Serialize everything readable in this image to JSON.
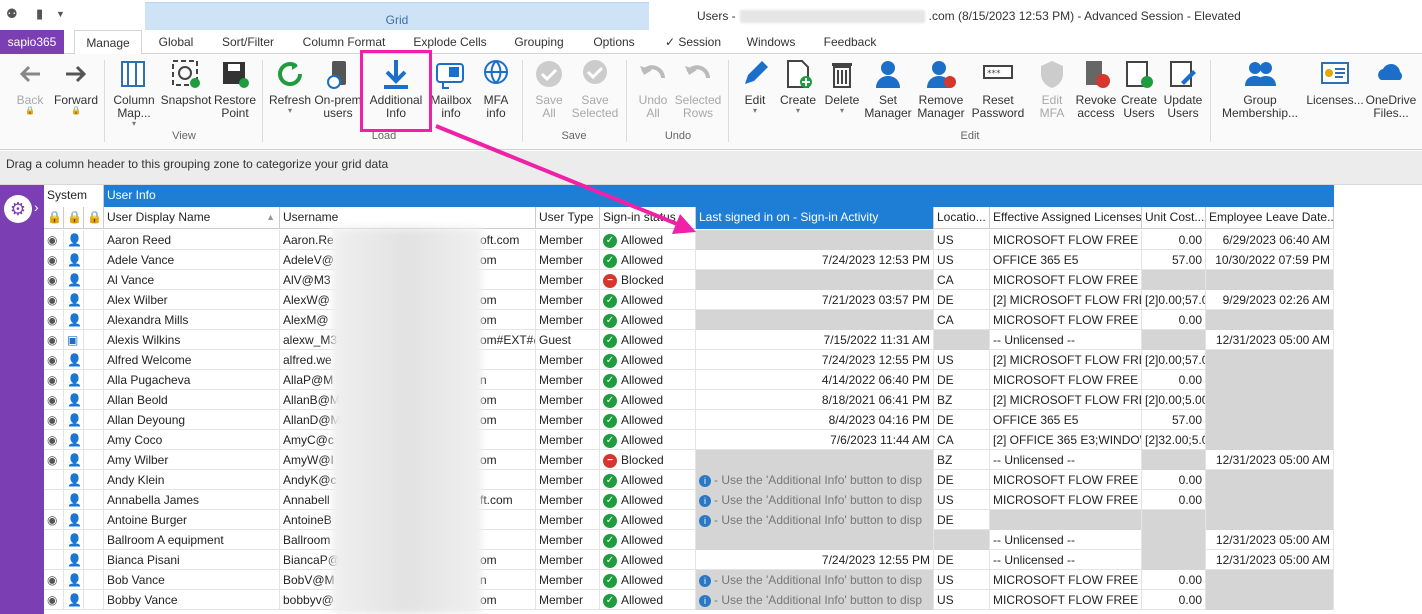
{
  "window": {
    "title_prefix": "Users -",
    "title_suffix": ".com (8/15/2023 12:53 PM) - Advanced Session - Elevated",
    "context_tab": "Grid"
  },
  "tabs": [
    "sapio365",
    "Manage",
    "Global",
    "Sort/Filter",
    "Column Format",
    "Explode Cells",
    "Grouping",
    "Options",
    "✓ Session",
    "Windows",
    "Feedback"
  ],
  "ribbon": {
    "back": "Back",
    "forward": "Forward",
    "column_map": "Column Map...",
    "snapshot": "Snapshot",
    "restore": "Restore Point",
    "view_group": "View",
    "refresh": "Refresh",
    "onprem": "On-prem users",
    "additional": "Additional Info",
    "mailbox": "Mailbox info",
    "mfa": "MFA info",
    "load_group": "Load",
    "save_all": "Save All",
    "save_selected": "Save Selected",
    "save_group": "Save",
    "undo_all": "Undo All",
    "undo_selected": "Selected Rows",
    "undo_group": "Undo",
    "edit": "Edit",
    "create": "Create",
    "delete": "Delete",
    "set_manager": "Set Manager",
    "remove_manager": "Remove Manager",
    "reset_password": "Reset Password",
    "edit_mfa": "Edit MFA",
    "revoke": "Revoke access",
    "create_users": "Create Users",
    "update_users": "Update Users",
    "edit_group": "Edit",
    "group_membership": "Group Membership...",
    "licenses": "Licenses...",
    "onedrive": "OneDrive Files..."
  },
  "groupzone": "Drag a column header to this grouping zone to categorize your grid data",
  "bands": {
    "system": "System",
    "userinfo": "User Info"
  },
  "columns": [
    "User Display Name",
    "Username",
    "User Type",
    "Sign-in status",
    "Last signed in on - Sign-in Activity",
    "Locatio...",
    "Effective Assigned Licenses",
    "Unit Cost...",
    "Employee Leave Date..."
  ],
  "hint_text": "- Use the 'Additional Info' button to disp",
  "rows": [
    {
      "name": "Aaron Reed",
      "user": "Aaron.Re",
      "user_end": "oft.com",
      "type": "Member",
      "status": "Allowed",
      "last": "",
      "loc": "US",
      "lic": "MICROSOFT FLOW FREE",
      "cost": "0.00",
      "leave": "6/29/2023 06:40 AM",
      "sys": true,
      "icon": "user"
    },
    {
      "name": "Adele Vance",
      "user": "AdeleV@",
      "user_end": "om",
      "type": "Member",
      "status": "Allowed",
      "last": "7/24/2023 12:53 PM",
      "loc": "US",
      "lic": "OFFICE 365 E5",
      "cost": "57.00",
      "leave": "10/30/2022 07:59 PM",
      "sys": true,
      "icon": "user"
    },
    {
      "name": "Al Vance",
      "user": "AlV@M3",
      "user_end": "",
      "type": "Member",
      "status": "Blocked",
      "last": "",
      "loc": "CA",
      "lic": "MICROSOFT FLOW FREE",
      "cost": "",
      "leave": "",
      "sys": true,
      "icon": "user"
    },
    {
      "name": "Alex Wilber",
      "user": "AlexW@",
      "user_end": "om",
      "type": "Member",
      "status": "Allowed",
      "last": "7/21/2023 03:57 PM",
      "loc": "DE",
      "lic": "[2] MICROSOFT FLOW FREE;",
      "cost": "[2]0.00;57.0",
      "leave": "9/29/2023 02:26 AM",
      "sys": true,
      "icon": "user"
    },
    {
      "name": "Alexandra Mills",
      "user": "AlexM@",
      "user_end": "om",
      "type": "Member",
      "status": "Allowed",
      "last": "",
      "loc": "CA",
      "lic": "MICROSOFT FLOW FREE",
      "cost": "0.00",
      "leave": "",
      "sys": true,
      "icon": "user"
    },
    {
      "name": "Alexis Wilkins",
      "user": "alexw_M3",
      "user_end": "om#EXT#@",
      "type": "Guest",
      "status": "Allowed",
      "last": "7/15/2022 11:31 AM",
      "loc": "",
      "lic": "-- Unlicensed --",
      "cost": "",
      "leave": "12/31/2023 05:00 AM",
      "sys": true,
      "icon": "guest"
    },
    {
      "name": "Alfred Welcome",
      "user": "alfred.we",
      "user_end": "",
      "type": "Member",
      "status": "Allowed",
      "last": "7/24/2023 12:55 PM",
      "loc": "US",
      "lic": "[2] MICROSOFT FLOW FREE;",
      "cost": "[2]0.00;57.0",
      "leave": "",
      "sys": true,
      "icon": "user"
    },
    {
      "name": "Alla Pugacheva",
      "user": "AllaP@M",
      "user_end": "n",
      "type": "Member",
      "status": "Allowed",
      "last": "4/14/2022 06:40 PM",
      "loc": "DE",
      "lic": "MICROSOFT FLOW FREE",
      "cost": "0.00",
      "leave": "",
      "sys": true,
      "icon": "user"
    },
    {
      "name": "Allan Beold",
      "user": "AllanB@M",
      "user_end": "om",
      "type": "Member",
      "status": "Allowed",
      "last": "8/18/2021 06:41 PM",
      "loc": "BZ",
      "lic": "[2] MICROSOFT FLOW FREE;",
      "cost": "[2]0.00;5.00",
      "leave": "",
      "sys": true,
      "icon": "user"
    },
    {
      "name": "Allan Deyoung",
      "user": "AllanD@M",
      "user_end": "om",
      "type": "Member",
      "status": "Allowed",
      "last": "8/4/2023 04:16 PM",
      "loc": "DE",
      "lic": "OFFICE 365 E5",
      "cost": "57.00",
      "leave": "",
      "sys": true,
      "icon": "user"
    },
    {
      "name": "Amy Coco",
      "user": "AmyC@c",
      "user_end": "",
      "type": "Member",
      "status": "Allowed",
      "last": "7/6/2023 11:44 AM",
      "loc": "CA",
      "lic": "[2] OFFICE 365 E3;WINDOWS",
      "cost": "[2]32.00;5.0",
      "leave": "",
      "sys": true,
      "icon": "user"
    },
    {
      "name": "Amy Wilber",
      "user": "AmyW@I",
      "user_end": "om",
      "type": "Member",
      "status": "Blocked",
      "last": "",
      "loc": "BZ",
      "lic": "-- Unlicensed --",
      "cost": "",
      "leave": "12/31/2023 05:00 AM",
      "sys": true,
      "icon": "user"
    },
    {
      "name": "Andy Klein",
      "user": "AndyK@c",
      "user_end": "",
      "type": "Member",
      "status": "Allowed",
      "last": "hint",
      "loc": "DE",
      "lic": "MICROSOFT FLOW FREE",
      "cost": "0.00",
      "leave": "",
      "sys": false,
      "icon": "user"
    },
    {
      "name": "Annabella James",
      "user": "Annabell",
      "user_end": "ft.com",
      "type": "Member",
      "status": "Allowed",
      "last": "hint",
      "loc": "US",
      "lic": "MICROSOFT FLOW FREE",
      "cost": "0.00",
      "leave": "",
      "sys": false,
      "icon": "user"
    },
    {
      "name": "Antoine Burger",
      "user": "AntoineB",
      "user_end": "",
      "type": "Member",
      "status": "Allowed",
      "last": "hint",
      "loc": "DE",
      "lic": "",
      "cost": "",
      "leave": "",
      "sys": true,
      "icon": "user"
    },
    {
      "name": "Ballroom A equipment",
      "user": "Ballroom",
      "user_end": "",
      "type": "Member",
      "status": "Allowed",
      "last": "",
      "loc": "",
      "lic": "-- Unlicensed --",
      "cost": "",
      "leave": "12/31/2023 05:00 AM",
      "sys": false,
      "icon": "user"
    },
    {
      "name": "Bianca Pisani",
      "user": "BiancaP@",
      "user_end": "om",
      "type": "Member",
      "status": "Allowed",
      "last": "7/24/2023 12:55 PM",
      "loc": "DE",
      "lic": "-- Unlicensed --",
      "cost": "",
      "leave": "12/31/2023 05:00 AM",
      "sys": false,
      "icon": "user"
    },
    {
      "name": "Bob Vance",
      "user": "BobV@M",
      "user_end": "n",
      "type": "Member",
      "status": "Allowed",
      "last": "hint",
      "loc": "US",
      "lic": "MICROSOFT FLOW FREE",
      "cost": "0.00",
      "leave": "",
      "sys": true,
      "icon": "user"
    },
    {
      "name": "Bobby Vance",
      "user": "bobbyv@",
      "user_end": "om",
      "type": "Member",
      "status": "Allowed",
      "last": "hint",
      "loc": "US",
      "lic": "MICROSOFT FLOW FREE",
      "cost": "0.00",
      "leave": "",
      "sys": true,
      "icon": "user"
    }
  ]
}
